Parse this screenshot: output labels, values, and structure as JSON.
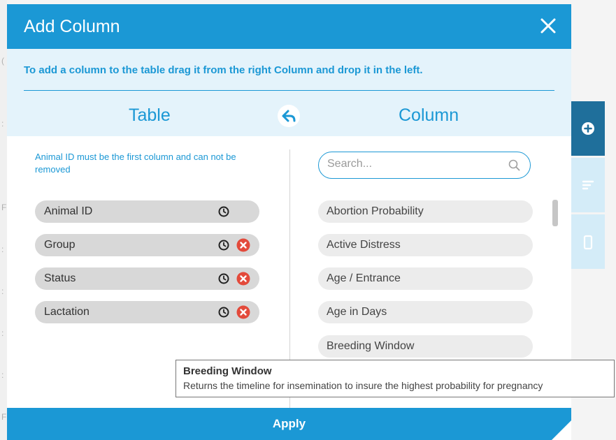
{
  "dialog": {
    "title": "Add Column",
    "instruction": "To add a column to the table drag it from the right Column and drop it in the left.",
    "table_heading": "Table",
    "column_heading": "Column",
    "note": "Animal ID must be the first column and can not be removed",
    "apply_label": "Apply"
  },
  "table_columns": [
    {
      "label": "Animal ID",
      "removable": false
    },
    {
      "label": "Group",
      "removable": true
    },
    {
      "label": "Status",
      "removable": true
    },
    {
      "label": "Lactation",
      "removable": true
    }
  ],
  "search": {
    "placeholder": "Search...",
    "value": ""
  },
  "available_columns": [
    "Abortion Probability",
    "Active Distress",
    "Age / Entrance",
    "Age in Days",
    "Breeding Window"
  ],
  "tooltip": {
    "title": "Breeding Window",
    "text": "Returns the timeline for  insemination to insure the highest probability for pregnancy"
  },
  "side_toolbar": [
    "plus-circle-icon",
    "sort-icon",
    "mobile-icon"
  ],
  "colors": {
    "accent": "#1b98d5",
    "info_bg": "#e4f3fb",
    "remove": "#e34a3b",
    "sidebar_active": "#1f6f9b"
  }
}
